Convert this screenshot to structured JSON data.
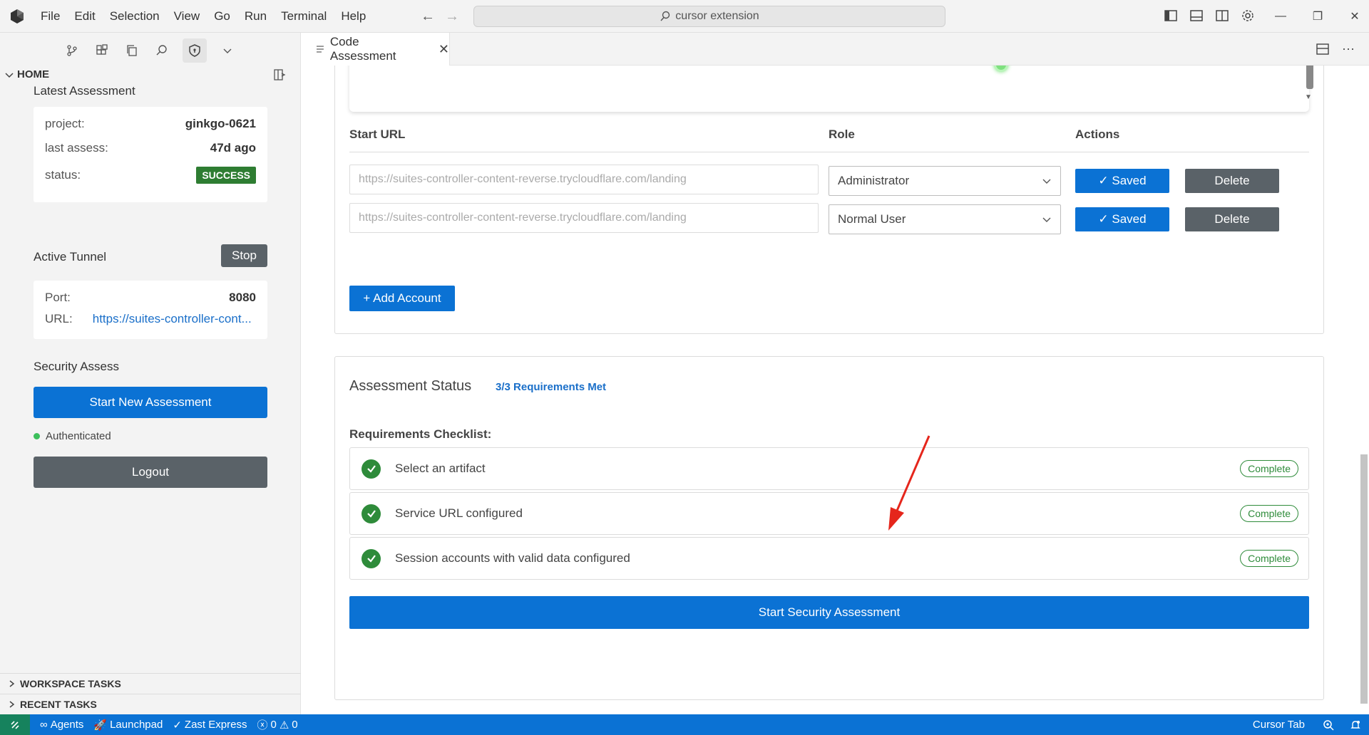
{
  "titlebar": {
    "menu": [
      "File",
      "Edit",
      "Selection",
      "View",
      "Go",
      "Run",
      "Terminal",
      "Help"
    ],
    "search_text": "cursor extension",
    "window_controls": [
      "—",
      "❐",
      "✕"
    ]
  },
  "sidebar": {
    "home_label": "HOME",
    "latest_assessment": {
      "title": "Latest Assessment",
      "project_key": "project:",
      "project_value": "ginkgo-0621",
      "last_assess_key": "last assess:",
      "last_assess_value": "47d ago",
      "status_key": "status:",
      "status_value": "SUCCESS"
    },
    "active_tunnel": {
      "title": "Active Tunnel",
      "stop_label": "Stop",
      "port_key": "Port:",
      "port_value": "8080",
      "url_key": "URL:",
      "url_value": "https://suites-controller-cont..."
    },
    "security_assess": {
      "title": "Security Assess",
      "start_label": "Start New Assessment",
      "auth_status": "Authenticated",
      "logout_label": "Logout"
    },
    "sections": [
      "WORKSPACE TASKS",
      "RECENT TASKS"
    ]
  },
  "editor": {
    "tab_label": "Code Assessment",
    "accounts_table": {
      "headers": [
        "Start URL",
        "Role",
        "Actions"
      ],
      "rows": [
        {
          "url_placeholder": "https://suites-controller-content-reverse.trycloudflare.com/landing",
          "role": "Administrator",
          "saved_label": "✓ Saved",
          "delete_label": "Delete"
        },
        {
          "url_placeholder": "https://suites-controller-content-reverse.trycloudflare.com/landing",
          "role": "Normal User",
          "saved_label": "✓ Saved",
          "delete_label": "Delete"
        }
      ],
      "add_label": "+ Add Account"
    },
    "assessment_status": {
      "title": "Assessment Status",
      "requirements_met": "3/3 Requirements Met",
      "checklist_title": "Requirements Checklist:",
      "items": [
        {
          "label": "Select an artifact",
          "status": "Complete"
        },
        {
          "label": "Service URL configured",
          "status": "Complete"
        },
        {
          "label": "Session accounts with valid data configured",
          "status": "Complete"
        }
      ],
      "start_label": "Start Security Assessment"
    }
  },
  "statusbar": {
    "agents": "Agents",
    "launchpad": "Launchpad",
    "zast_express": "Zast Express",
    "errors": "0",
    "warnings": "0",
    "cursor_tab": "Cursor Tab"
  },
  "colors": {
    "accent": "#0b72d4",
    "secondary_button": "#5a6268",
    "success": "#2e7d32",
    "statusbar": "#0b72d4"
  }
}
